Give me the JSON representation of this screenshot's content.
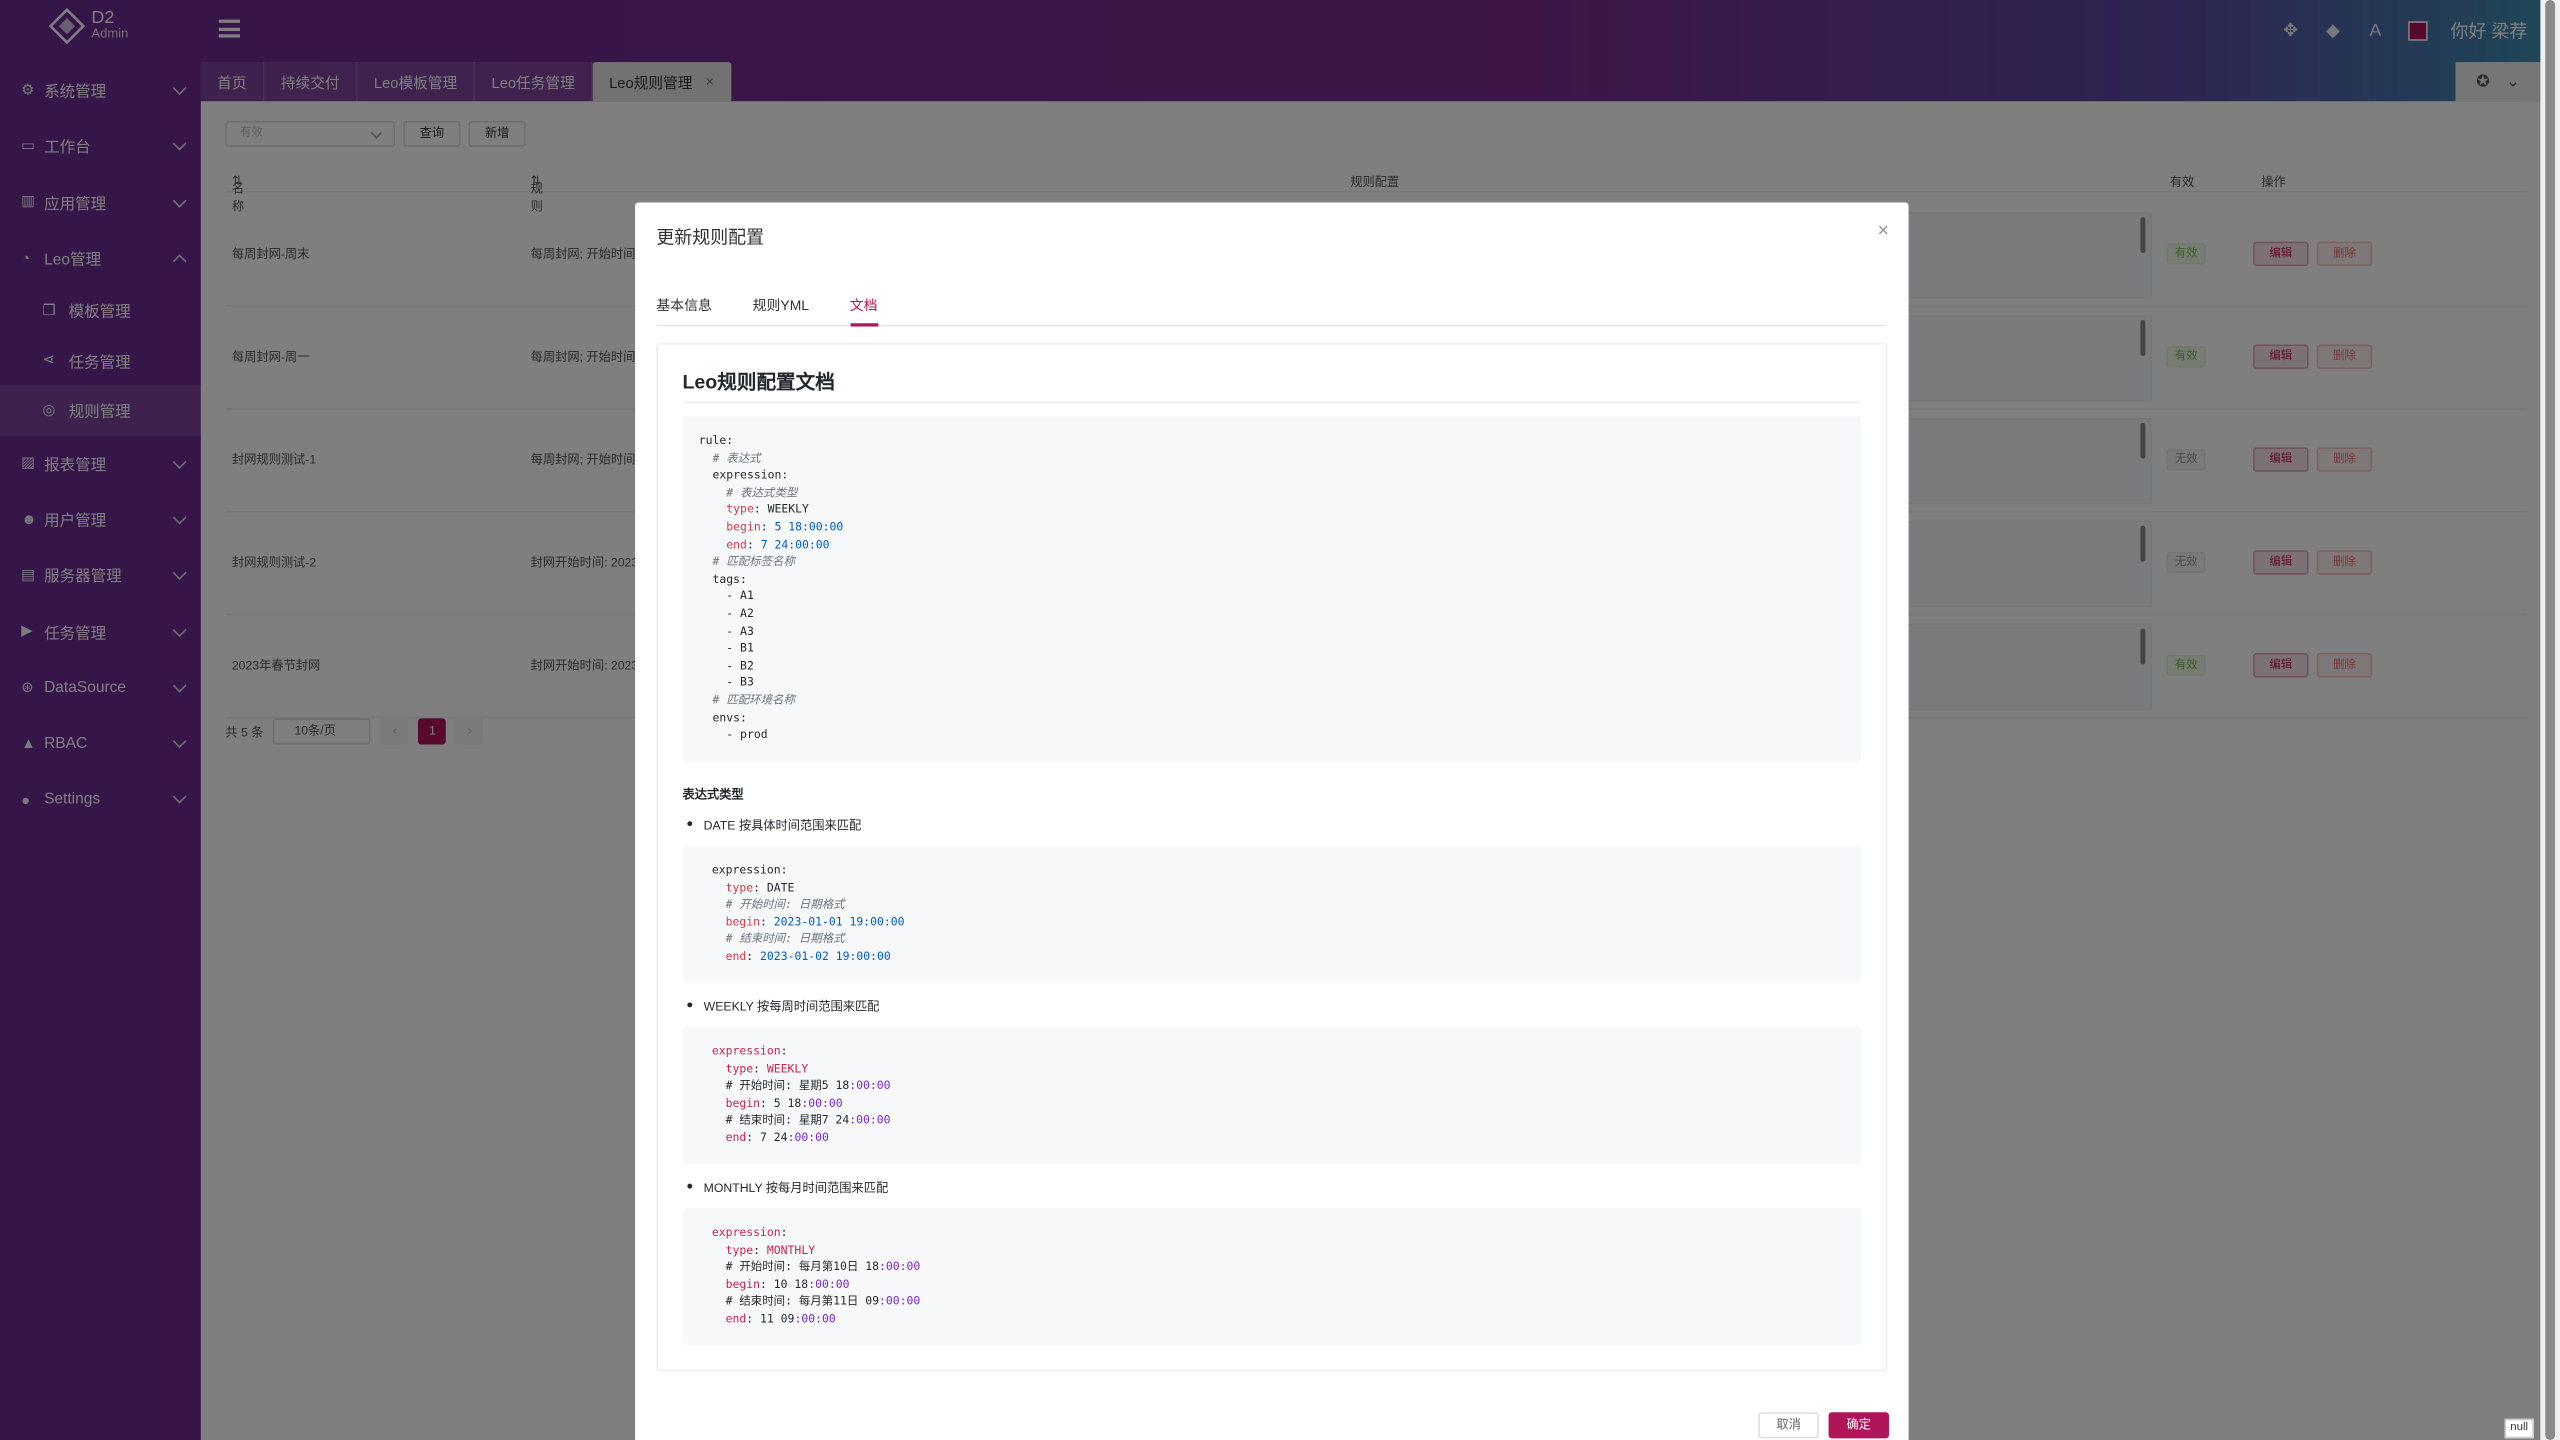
{
  "app": {
    "logo_title": "D2",
    "logo_sub": "Admin",
    "greeting": "你好 梁荐"
  },
  "sidebar": {
    "items": [
      {
        "label": "系统管理",
        "icon": "gear-icon",
        "glyph": "⚙"
      },
      {
        "label": "工作台",
        "icon": "monitor-icon",
        "glyph": "▭"
      },
      {
        "label": "应用管理",
        "icon": "bar-chart-icon",
        "glyph": "▥"
      },
      {
        "label": "Leo管理",
        "icon": "dashboard-icon",
        "glyph": "◔"
      },
      {
        "label": "模板管理",
        "icon": "copy-icon",
        "glyph": "❐"
      },
      {
        "label": "任务管理",
        "icon": "share-icon",
        "glyph": "⋖"
      },
      {
        "label": "规则管理",
        "icon": "compass-icon",
        "glyph": "◎"
      },
      {
        "label": "报表管理",
        "icon": "line-chart-icon",
        "glyph": "▨"
      },
      {
        "label": "用户管理",
        "icon": "users-icon",
        "glyph": "☻"
      },
      {
        "label": "服务器管理",
        "icon": "server-icon",
        "glyph": "▤"
      },
      {
        "label": "任务管理",
        "icon": "play-icon",
        "glyph": "▶"
      },
      {
        "label": "DataSource",
        "icon": "database-icon",
        "glyph": "⊛"
      },
      {
        "label": "RBAC",
        "icon": "shield-icon",
        "glyph": "▲"
      },
      {
        "label": "Settings",
        "icon": "user-circle-icon",
        "glyph": "●"
      }
    ]
  },
  "tabs": [
    "首页",
    "持续交付",
    "Leo模板管理",
    "Leo任务管理",
    "Leo规则管理"
  ],
  "filter": {
    "select_placeholder": "有效",
    "query": "查询",
    "add": "新增"
  },
  "table": {
    "headers": {
      "name": "名称",
      "rule": "规则",
      "config": "规则配置",
      "valid": "有效",
      "ops": "操作"
    },
    "rows": [
      {
        "name": "每周封网-周末",
        "rule": "每周封网; 开始时间:",
        "valid": "有效",
        "on": true
      },
      {
        "name": "每周封网-周一",
        "rule": "每周封网; 开始时间:",
        "valid": "有效",
        "on": true
      },
      {
        "name": "封网规则测试-1",
        "rule": "每周封网; 开始时间:",
        "valid": "无效",
        "on": false
      },
      {
        "name": "封网规则测试-2",
        "rule": "封网开始时间: 2023",
        "valid": "无效",
        "on": false
      },
      {
        "name": "2023年春节封网",
        "rule": "封网开始时间: 2023",
        "valid": "有效",
        "on": true
      }
    ],
    "edit": "编辑",
    "delete": "删除"
  },
  "pager": {
    "total": "共 5 条",
    "size": "10条/页",
    "page": "1"
  },
  "dialog": {
    "title": "更新规则配置",
    "tabs": [
      "基本信息",
      "规则YML",
      "文档"
    ],
    "doc_title": "Leo规则配置文档",
    "section": "表达式类型",
    "items": [
      "DATE 按具体时间范围来匹配",
      "WEEKLY 按每周时间范围来匹配",
      "MONTHLY 按每月时间范围来匹配"
    ],
    "cancel": "取消",
    "ok": "确定"
  },
  "misc": {
    "null_label": "null"
  },
  "colors": {
    "accent": "#b0155a",
    "sidebar": "#7a2c8f"
  }
}
